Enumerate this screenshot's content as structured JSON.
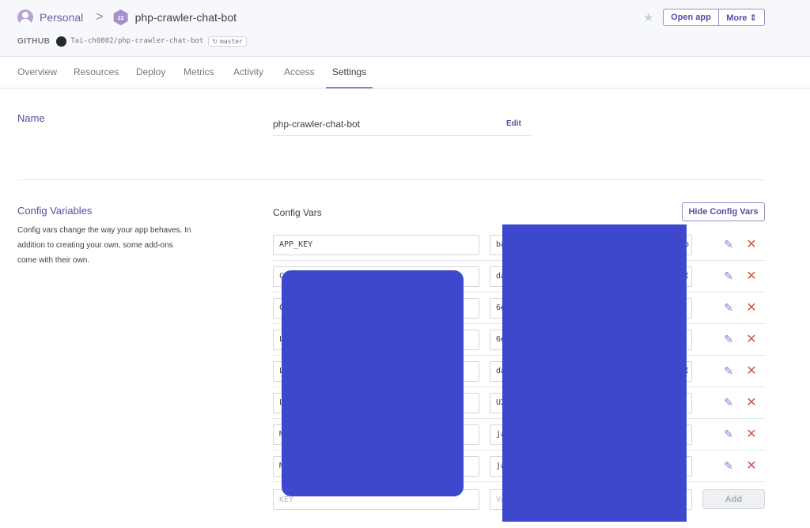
{
  "header": {
    "personal_label": "Personal",
    "separator": ">",
    "app_icon_glyph": "zz",
    "app_name": "php-crawler-chat-bot",
    "github_label": "GITHUB",
    "repo": "Tai-ch0802/php-crawler-chat-bot",
    "branch_icon": "↻",
    "branch": "master",
    "star_glyph": "★",
    "open_app_label": "Open app",
    "more_label": "More ⇕"
  },
  "tabs": [
    {
      "label": "Overview"
    },
    {
      "label": "Resources"
    },
    {
      "label": "Deploy"
    },
    {
      "label": "Metrics"
    },
    {
      "label": "Activity"
    },
    {
      "label": "Access"
    },
    {
      "label": "Settings",
      "active": true
    }
  ],
  "name_section": {
    "label": "Name",
    "value": "php-crawler-chat-bot",
    "edit_label": "Edit"
  },
  "config_section": {
    "label": "Config Variables",
    "description": "Config vars change the way your app behaves. In addition to creating your own, some add-ons come with their own.",
    "heading": "Config Vars",
    "hide_button": "Hide Config Vars",
    "vars": [
      {
        "key": "APP_KEY",
        "value": "ba",
        "value_tail": "p"
      },
      {
        "key": "C",
        "value": "da",
        "value_tail": "I"
      },
      {
        "key": "C",
        "value": "6e",
        "value_tail": ""
      },
      {
        "key": "L",
        "value": "6e",
        "value_tail": ""
      },
      {
        "key": "L",
        "value": "da",
        "value_tail": "I"
      },
      {
        "key": "L",
        "value": "U2",
        "value_tail": ""
      },
      {
        "key": "M",
        "value": "ja",
        "value_tail": ""
      },
      {
        "key": "M",
        "value": "ja",
        "value_tail": ""
      }
    ],
    "new_key_placeholder": "KEY",
    "new_value_placeholder": "VA",
    "add_button": "Add",
    "edit_icon_glyph": "✎",
    "delete_icon_glyph": "✕"
  },
  "colors": {
    "accent": "#5b4ba0",
    "redaction": "#3e48cc",
    "delete": "#d9544d"
  }
}
